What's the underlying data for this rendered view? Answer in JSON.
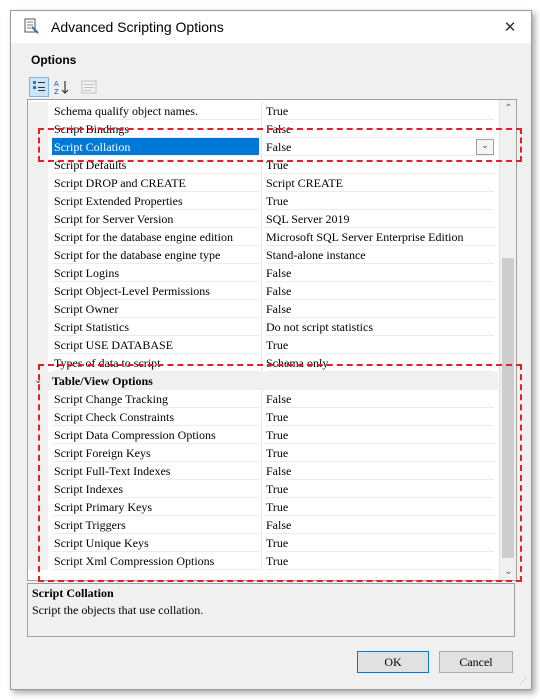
{
  "window": {
    "title": "Advanced Scripting Options",
    "close_glyph": "✕",
    "icon": "scripting-tool-icon"
  },
  "options_label": "Options",
  "toolbar": {
    "categorized_icon": "categorized-view-icon",
    "alphabetical_icon": "alphabetical-sort-icon",
    "property_pages_icon": "property-pages-icon"
  },
  "grid": {
    "rows": [
      {
        "name": "Schema qualify object names.",
        "value": "True"
      },
      {
        "name": "Script Bindings",
        "value": "False"
      },
      {
        "name": "Script Collation",
        "value": "False",
        "selected": true
      },
      {
        "name": "Script Defaults",
        "value": "True"
      },
      {
        "name": "Script DROP and CREATE",
        "value": "Script CREATE"
      },
      {
        "name": "Script Extended Properties",
        "value": "True"
      },
      {
        "name": "Script for Server Version",
        "value": "SQL Server 2019"
      },
      {
        "name": "Script for the database engine edition",
        "value": "Microsoft SQL Server Enterprise Edition"
      },
      {
        "name": "Script for the database engine type",
        "value": "Stand-alone instance"
      },
      {
        "name": "Script Logins",
        "value": "False"
      },
      {
        "name": "Script Object-Level Permissions",
        "value": "False"
      },
      {
        "name": "Script Owner",
        "value": "False"
      },
      {
        "name": "Script Statistics",
        "value": "Do not script statistics"
      },
      {
        "name": "Script USE DATABASE",
        "value": "True"
      },
      {
        "name": "Types of data to script",
        "value": "Schema only"
      }
    ],
    "category_title": "Table/View Options",
    "category_glyph": "⌄",
    "table_rows": [
      {
        "name": "Script Change Tracking",
        "value": "False"
      },
      {
        "name": "Script Check Constraints",
        "value": "True"
      },
      {
        "name": "Script Data Compression Options",
        "value": "True"
      },
      {
        "name": "Script Foreign Keys",
        "value": "True"
      },
      {
        "name": "Script Full-Text Indexes",
        "value": "False"
      },
      {
        "name": "Script Indexes",
        "value": "True"
      },
      {
        "name": "Script Primary Keys",
        "value": "True"
      },
      {
        "name": "Script Triggers",
        "value": "False"
      },
      {
        "name": "Script Unique Keys",
        "value": "True"
      },
      {
        "name": "Script Xml Compression Options",
        "value": "True"
      }
    ],
    "dropdown_glyph": "⌄",
    "scroll_up_glyph": "⌃",
    "scroll_down_glyph": "⌄"
  },
  "description": {
    "title": "Script Collation",
    "text": "Script the objects that use collation."
  },
  "buttons": {
    "ok": "OK",
    "cancel": "Cancel"
  },
  "colors": {
    "selection": "#0078d7",
    "annotation": "#e0202a"
  }
}
